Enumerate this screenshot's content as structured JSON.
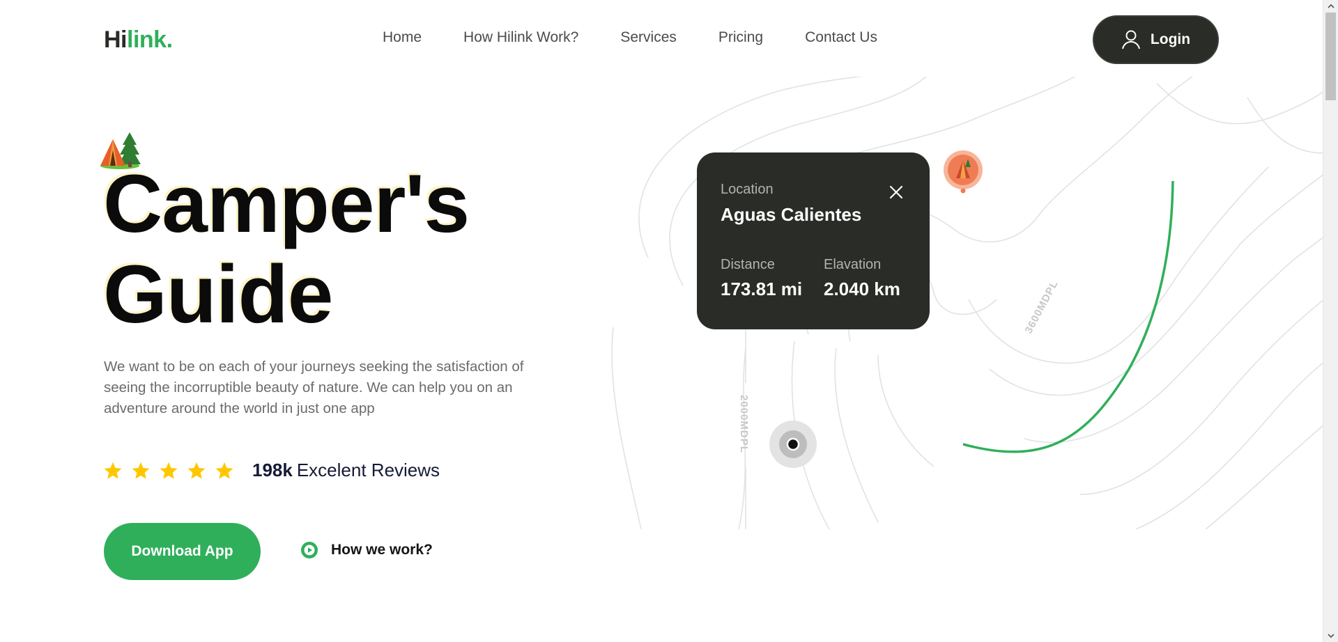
{
  "brand": {
    "logo_dark": "Hi",
    "logo_accent": "link.",
    "accent_color": "#30af5b",
    "dark_color": "#292c27"
  },
  "nav": {
    "items": [
      {
        "label": "Home"
      },
      {
        "label": "How Hilink Work?"
      },
      {
        "label": "Services"
      },
      {
        "label": "Pricing"
      },
      {
        "label": "Contact Us"
      }
    ],
    "login_label": "Login",
    "login_icon": "user-icon"
  },
  "hero": {
    "title_line1": "Camper's",
    "title_line2": "Guide",
    "title_icon": "camp-tent-icon",
    "description": "We want to be on each of your journeys seeking the satisfaction of seeing the incorruptible beauty of nature. We can help you on an adventure around the world in just one app",
    "rating": {
      "stars": 5,
      "count": "198k",
      "text": "Excelent Reviews",
      "star_color": "#ffc700"
    },
    "download_label": "Download App",
    "how_label": "How we work?"
  },
  "map": {
    "contour_label_1": "3600MDPL",
    "contour_label_2": "2000MDPL",
    "card": {
      "location_label": "Location",
      "location_name": "Aguas Calientes",
      "distance_label": "Distance",
      "distance_value": "173.81 mi",
      "elevation_label": "Elavation",
      "elevation_value": "2.040 km"
    }
  }
}
